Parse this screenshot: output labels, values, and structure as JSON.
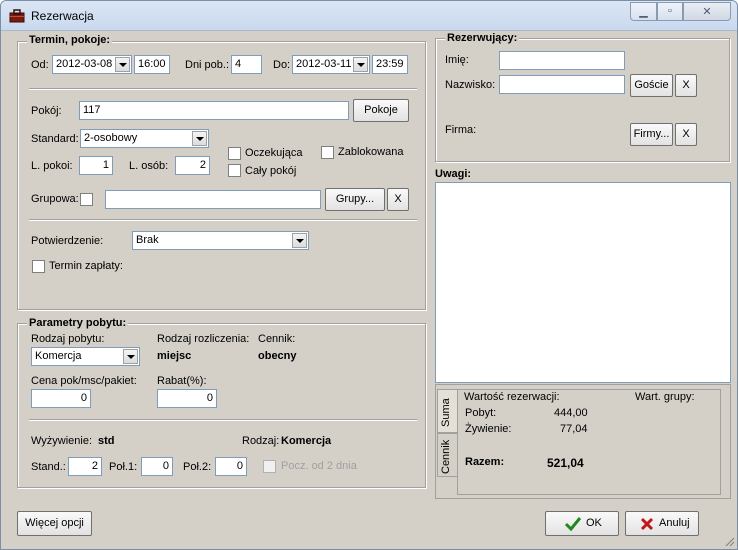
{
  "window": {
    "title": "Rezerwacja"
  },
  "termin": {
    "group_title": "Termin, pokoje:",
    "od_label": "Od:",
    "od_date": "2012-03-08",
    "od_time": "16:00",
    "dni_label": "Dni pob.:",
    "dni_value": "4",
    "do_label": "Do:",
    "do_date": "2012-03-11",
    "do_time": "23:59",
    "pokoj_label": "Pokój:",
    "pokoj_value": "117",
    "pokoje_button": "Pokoje",
    "standard_label": "Standard:",
    "standard_value": "2-osobowy",
    "oczekujaca_label": "Oczekująca",
    "zablokowana_label": "Zablokowana",
    "caly_pokoj_label": "Cały pokój",
    "lpokoi_label": "L. pokoi:",
    "lpokoi_value": "1",
    "losob_label": "L. osób:",
    "losob_value": "2",
    "grupowa_label": "Grupowa:",
    "grupy_button": "Grupy...",
    "clear_label": "X",
    "potwierdzenie_label": "Potwierdzenie:",
    "potwierdzenie_value": "Brak",
    "termin_zaplaty_label": "Termin zapłaty:"
  },
  "parametry": {
    "group_title": "Parametry pobytu:",
    "rodzaj_pobytu_label": "Rodzaj pobytu:",
    "rodzaj_pobytu_value": "Komercja",
    "rodzaj_rozliczenia_label": "Rodzaj rozliczenia:",
    "rodzaj_rozliczenia_value": "miejsc",
    "cennik_label": "Cennik:",
    "cennik_value": "obecny",
    "cena_label": "Cena pok/msc/pakiet:",
    "cena_value": "0",
    "rabat_label": "Rabat(%):",
    "rabat_value": "0",
    "wyzywienie_label": "Wyżywienie:",
    "wyzywienie_value": "std",
    "rodzaj_label": "Rodzaj:",
    "rodzaj_value": "Komercja",
    "stand_label": "Stand.:",
    "stand_value": "2",
    "pol1_label": "Poł.1:",
    "pol1_value": "0",
    "pol2_label": "Poł.2:",
    "pol2_value": "0",
    "pocz_label": "Pocz. od 2 dnia"
  },
  "rezerwujacy": {
    "group_title": "Rezerwujący:",
    "imie_label": "Imię:",
    "imie_value": "",
    "nazwisko_label": "Nazwisko:",
    "nazwisko_value": "",
    "goscie_button": "Goście",
    "clear_label": "X",
    "firma_label": "Firma:",
    "firmy_button": "Firmy..."
  },
  "uwagi": {
    "label": "Uwagi:",
    "value": ""
  },
  "summary": {
    "tabs": [
      "Suma",
      "Cennik"
    ],
    "wartosc_label": "Wartość rezerwacji:",
    "wart_grupy_label": "Wart. grupy:",
    "pobyt_label": "Pobyt:",
    "pobyt_value": "444,00",
    "zywienie_label": "Żywienie:",
    "zywienie_value": "77,04",
    "razem_label": "Razem:",
    "razem_value": "521,04"
  },
  "footer": {
    "wiecej_button": "Więcej opcji",
    "ok_button": "OK",
    "anuluj_button": "Anuluj"
  },
  "colors": {
    "ok_check": "#1e8a1e",
    "cancel_x": "#c01818",
    "dialog_bg": "#d4d0c8"
  }
}
